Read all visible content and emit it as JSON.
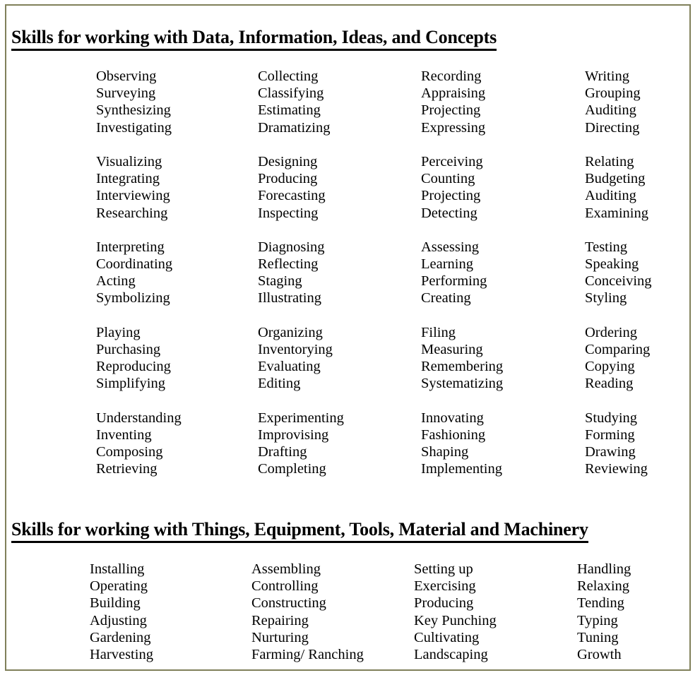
{
  "document": {
    "border_color": "#80805a",
    "text_color": "#000000",
    "background_color": "#ffffff"
  },
  "sections": [
    {
      "id": "data-information-ideas-concepts",
      "heading": "Skills for working with Data, Information, Ideas, and Concepts",
      "columns": [
        {
          "id": "column-1",
          "groups": [
            [
              "Observing",
              "Surveying",
              "Synthesizing",
              "Investigating"
            ],
            [
              "Visualizing",
              "Integrating",
              "Interviewing",
              "Researching"
            ],
            [
              "Interpreting",
              "Coordinating",
              "Acting",
              "Symbolizing"
            ],
            [
              "Playing",
              "Purchasing",
              "Reproducing",
              "Simplifying"
            ],
            [
              "Understanding",
              "Inventing",
              "Composing",
              "Retrieving"
            ]
          ]
        },
        {
          "id": "column-2",
          "groups": [
            [
              "Collecting",
              "Classifying",
              "Estimating",
              "Dramatizing"
            ],
            [
              "Designing",
              "Producing",
              "Forecasting",
              "Inspecting"
            ],
            [
              "Diagnosing",
              "Reflecting",
              "Staging",
              "Illustrating"
            ],
            [
              "Organizing",
              "Inventorying",
              "Evaluating",
              "Editing"
            ],
            [
              "Experimenting",
              "Improvising",
              "Drafting",
              "Completing"
            ]
          ]
        },
        {
          "id": "column-3",
          "groups": [
            [
              "Recording",
              "Appraising",
              "Projecting",
              "Expressing"
            ],
            [
              "Perceiving",
              "Counting",
              "Projecting",
              "Detecting"
            ],
            [
              "Assessing",
              "Learning",
              "Performing",
              "Creating"
            ],
            [
              "Filing",
              "Measuring",
              "Remembering",
              "Systematizing"
            ],
            [
              "Innovating",
              "Fashioning",
              "Shaping",
              "Implementing"
            ]
          ]
        },
        {
          "id": "column-4",
          "groups": [
            [
              "Writing",
              "Grouping",
              "Auditing",
              "Directing"
            ],
            [
              "Relating",
              "Budgeting",
              "Auditing",
              "Examining"
            ],
            [
              "Testing",
              "Speaking",
              "Conceiving",
              "Styling"
            ],
            [
              "Ordering",
              "Comparing",
              "Copying",
              "Reading"
            ],
            [
              "Studying",
              "Forming",
              "Drawing",
              "Reviewing"
            ]
          ]
        }
      ]
    },
    {
      "id": "things-equipment-tools-material-machinery",
      "heading": "Skills for working with Things, Equipment, Tools, Material and Machinery",
      "columns": [
        {
          "id": "column-1",
          "groups": [
            [
              "Installing",
              "Operating",
              "Building",
              "Adjusting",
              "Gardening",
              "Harvesting"
            ]
          ]
        },
        {
          "id": "column-2",
          "groups": [
            [
              "Assembling",
              "Controlling",
              "Constructing",
              "Repairing",
              "Nurturing",
              "Farming/ Ranching"
            ]
          ]
        },
        {
          "id": "column-3",
          "groups": [
            [
              "Setting up",
              "Exercising",
              "Producing",
              "Key Punching",
              "Cultivating",
              "Landscaping"
            ]
          ]
        },
        {
          "id": "column-4",
          "groups": [
            [
              "Handling",
              "Relaxing",
              "Tending",
              "Typing",
              "Tuning",
              "Growth"
            ]
          ]
        }
      ]
    }
  ]
}
